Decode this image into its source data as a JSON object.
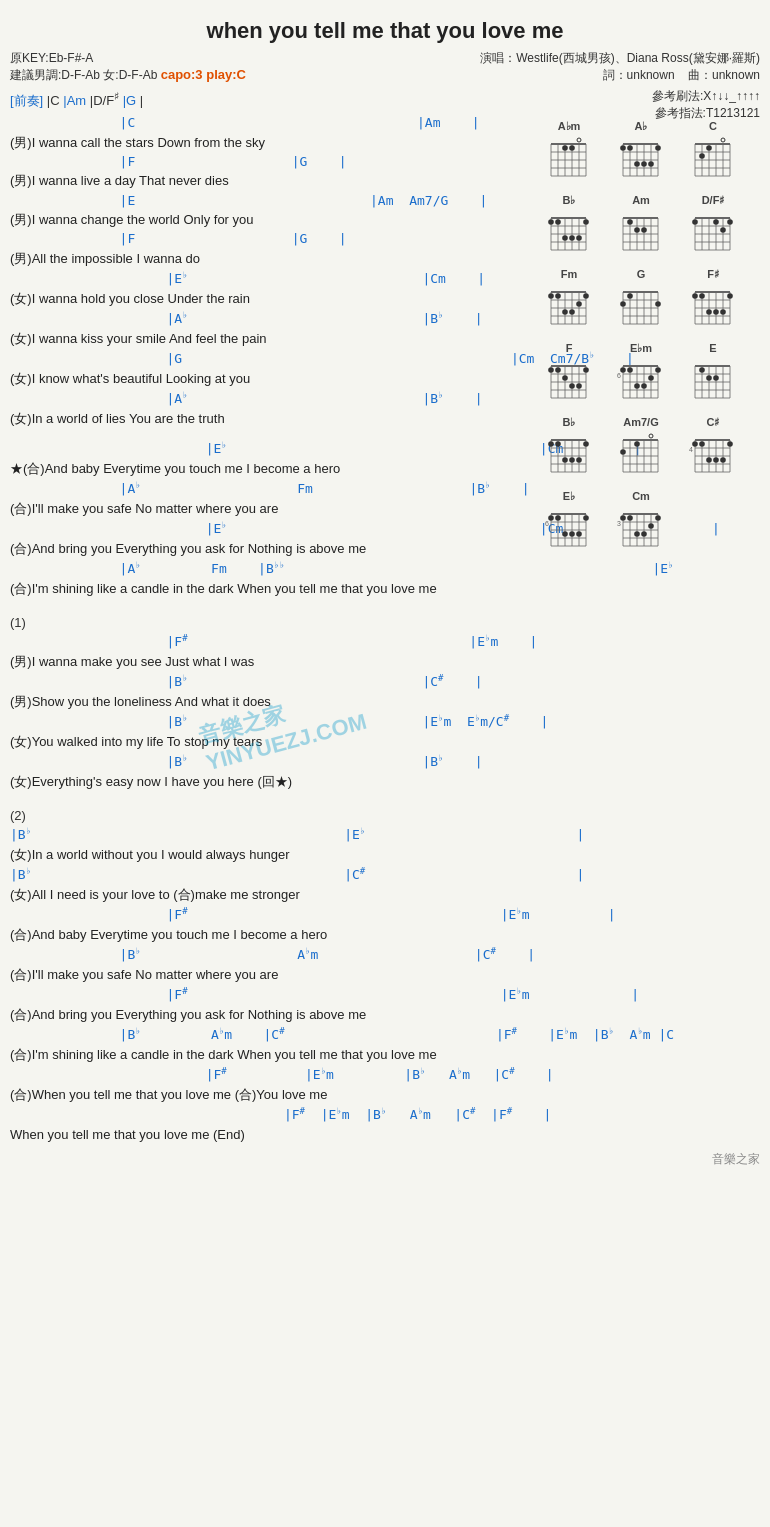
{
  "title": "when you tell me that you love me",
  "meta": {
    "key": "原KEY:Eb-F#-A",
    "suggested_male": "建議男調:D-F-Ab",
    "suggested_female": "女:D-F-Ab",
    "capo": "capo:3 play:C",
    "singer": "演唱：Westlife(西城男孩)、Diana Ross(黛安娜·羅斯)",
    "words": "詞：unknown",
    "music": "曲：unknown"
  },
  "strum": {
    "pattern1": "參考刷法:X↑↓↓_↑↑↑↑",
    "pattern2": "參考指法:T1213121"
  },
  "intro": "[前奏]  |C    |Am    |D/F#    |G    |",
  "chords_sidebar": [
    {
      "name": "Abm",
      "fret": "",
      "dots": "x x 4 4 3 x"
    },
    {
      "name": "Ab",
      "fret": "",
      "dots": "4 4 6 6 6 4"
    },
    {
      "name": "C",
      "fret": "open",
      "dots": "x 3 2 0 1 0"
    },
    {
      "name": "Bb",
      "fret": "",
      "dots": "6 6 8 8 8 6"
    },
    {
      "name": "Am",
      "fret": "open",
      "dots": "x 0 2 2 1 0"
    },
    {
      "name": "D/F#",
      "fret": "",
      "dots": "2 0 0 2 3 2"
    },
    {
      "name": "Fm",
      "fret": "",
      "dots": "1 1 3 3 2 1"
    },
    {
      "name": "G",
      "fret": "open",
      "dots": "3 2 0 0 0 3"
    },
    {
      "name": "F#",
      "fret": "",
      "dots": "2 2 4 4 4 2"
    },
    {
      "name": "F",
      "fret": "open",
      "dots": "1 1 3 3 2 1"
    },
    {
      "name": "Ebm",
      "fret": "6",
      "dots": "6 6 8 8 7 6"
    },
    {
      "name": "E",
      "fret": "open",
      "dots": "0 2 2 1 0 0"
    },
    {
      "name": "Bb",
      "fret": "",
      "dots": "6 6 8 8 8 6"
    },
    {
      "name": "Am7/G",
      "fret": "",
      "dots": "3 0 2 0 1 0"
    },
    {
      "name": "C#",
      "fret": "4",
      "dots": "4 4 6 6 6 4"
    },
    {
      "name": "Eb",
      "fret": "6",
      "dots": "6 6 8 8 8 6"
    },
    {
      "name": "Cm",
      "fret": "3",
      "dots": "3 3 5 5 4 3"
    }
  ],
  "lyrics": [
    {
      "type": "chord",
      "text": "              |C                                    |Am    |"
    },
    {
      "type": "lyric",
      "text": "(男)I wanna call the stars    Down from the sky"
    },
    {
      "type": "chord",
      "text": "              |F                    |G    |"
    },
    {
      "type": "lyric",
      "text": "(男)I wanna live a day    That never dies"
    },
    {
      "type": "chord",
      "text": "              |E                              |Am  Am7/G    |"
    },
    {
      "type": "lyric",
      "text": "(男)I wanna change the world    Only for you"
    },
    {
      "type": "chord",
      "text": "              |F                    |G    |"
    },
    {
      "type": "lyric",
      "text": "(男)All the impossible    I wanna do"
    },
    {
      "type": "chord",
      "text": "                    |E♭                              |Cm    |"
    },
    {
      "type": "lyric",
      "text": "(女)I wanna hold you close    Under the rain"
    },
    {
      "type": "chord",
      "text": "                    |A♭                              |B♭    |"
    },
    {
      "type": "lyric",
      "text": "(女)I wanna kiss your smile    And feel the pain"
    },
    {
      "type": "chord",
      "text": "                    |G                                          |Cm  Cm7/B♭    |"
    },
    {
      "type": "lyric",
      "text": "(女)I know what's beautiful    Looking at you"
    },
    {
      "type": "chord",
      "text": "                    |A♭                              |B♭    |"
    },
    {
      "type": "lyric",
      "text": "(女)In a world of lies    You are the truth"
    },
    {
      "type": "spacer"
    },
    {
      "type": "chord",
      "text": "                         |E♭                                        |Cm         |"
    },
    {
      "type": "lyric",
      "text": "★(合)And baby    Everytime you touch me    I become a hero"
    },
    {
      "type": "chord",
      "text": "              |A♭                    Fm                    |B♭    |"
    },
    {
      "type": "lyric",
      "text": "  (合)I'll make you safe    No matter where you are"
    },
    {
      "type": "chord",
      "text": "                         |E♭                                        |Cm                   |"
    },
    {
      "type": "lyric",
      "text": "  (合)And bring you    Everything you ask for    Nothing is above me"
    },
    {
      "type": "chord",
      "text": "              |A♭         Fm    |B♭♭                                               |E♭"
    },
    {
      "type": "lyric",
      "text": "  (合)I'm shining like a candle in the dark    When you tell me that you love me"
    },
    {
      "type": "spacer"
    },
    {
      "type": "section",
      "text": "(1)"
    },
    {
      "type": "chord",
      "text": "                    |F#                                    |E♭m    |"
    },
    {
      "type": "lyric",
      "text": "(男)I wanna make you see    Just what I was"
    },
    {
      "type": "chord",
      "text": "                    |B♭                              |C#    |"
    },
    {
      "type": "lyric",
      "text": "(男)Show you the loneliness    And what it does"
    },
    {
      "type": "chord",
      "text": "                    |B♭                              |E♭m  E♭m/C#    |"
    },
    {
      "type": "lyric",
      "text": "(女)You walked into my life    To stop my tears"
    },
    {
      "type": "chord",
      "text": "                    |B♭                              |B♭    |"
    },
    {
      "type": "lyric",
      "text": "(女)Everything's easy now    I have you here  (回★)"
    },
    {
      "type": "spacer"
    },
    {
      "type": "section",
      "text": "(2)"
    },
    {
      "type": "chord",
      "text": "|B♭                                        |E♭                           |"
    },
    {
      "type": "lyric",
      "text": "(女)In a world without you    I would always hunger"
    },
    {
      "type": "chord",
      "text": "|B♭                                        |C#                           |"
    },
    {
      "type": "lyric",
      "text": "(女)All I need is your love to   (合)make me stronger"
    },
    {
      "type": "chord",
      "text": "                    |F#                                        |E♭m          |"
    },
    {
      "type": "lyric",
      "text": "  (合)And baby    Everytime you touch me    I become a hero"
    },
    {
      "type": "chord",
      "text": "              |B♭                    A♭m                    |C#    |"
    },
    {
      "type": "lyric",
      "text": "  (合)I'll make you safe    No matter where you are"
    },
    {
      "type": "chord",
      "text": "                    |F#                                        |E♭m             |"
    },
    {
      "type": "lyric",
      "text": "  (合)And bring you    Everything you ask for    Nothing is above me"
    },
    {
      "type": "chord",
      "text": "              |B♭         A♭m    |C#                           |F#    |E♭m  |B♭  A♭m |C"
    },
    {
      "type": "lyric",
      "text": "  (合)I'm shining like a candle in the dark    When you tell me that you love me"
    },
    {
      "type": "chord",
      "text": "                         |F#          |E♭m         |B♭   A♭m   |C#    |"
    },
    {
      "type": "lyric",
      "text": "  (合)When you tell me that you love me    (合)You love me"
    },
    {
      "type": "chord",
      "text": "                                   |F#  |E♭m  |B♭   A♭m   |C#  |F#    |"
    },
    {
      "type": "lyric",
      "text": "When you tell me that you love me                             (End)"
    }
  ],
  "watermark": "音樂之家  YINYUEZJ.COM",
  "footer": "音樂之家"
}
